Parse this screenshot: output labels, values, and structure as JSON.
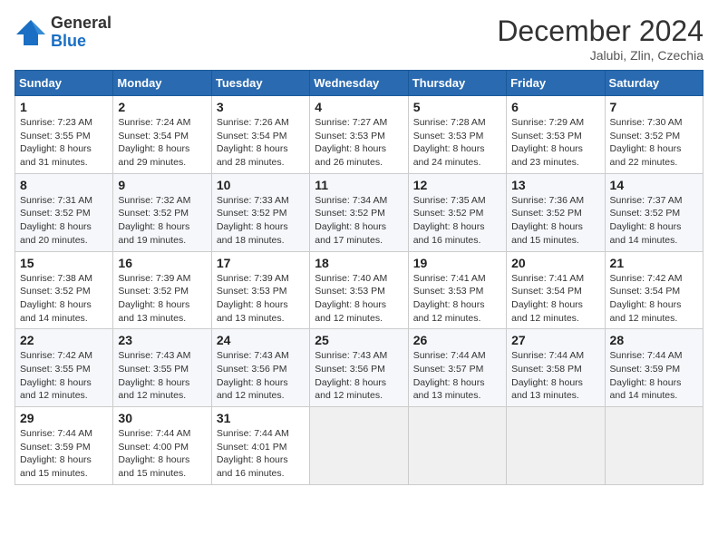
{
  "logo": {
    "general": "General",
    "blue": "Blue"
  },
  "header": {
    "title": "December 2024",
    "subtitle": "Jalubi, Zlin, Czechia"
  },
  "days_of_week": [
    "Sunday",
    "Monday",
    "Tuesday",
    "Wednesday",
    "Thursday",
    "Friday",
    "Saturday"
  ],
  "weeks": [
    [
      {
        "day": "1",
        "sunrise": "7:23 AM",
        "sunset": "3:55 PM",
        "daylight": "8 hours and 31 minutes."
      },
      {
        "day": "2",
        "sunrise": "7:24 AM",
        "sunset": "3:54 PM",
        "daylight": "8 hours and 29 minutes."
      },
      {
        "day": "3",
        "sunrise": "7:26 AM",
        "sunset": "3:54 PM",
        "daylight": "8 hours and 28 minutes."
      },
      {
        "day": "4",
        "sunrise": "7:27 AM",
        "sunset": "3:53 PM",
        "daylight": "8 hours and 26 minutes."
      },
      {
        "day": "5",
        "sunrise": "7:28 AM",
        "sunset": "3:53 PM",
        "daylight": "8 hours and 24 minutes."
      },
      {
        "day": "6",
        "sunrise": "7:29 AM",
        "sunset": "3:53 PM",
        "daylight": "8 hours and 23 minutes."
      },
      {
        "day": "7",
        "sunrise": "7:30 AM",
        "sunset": "3:52 PM",
        "daylight": "8 hours and 22 minutes."
      }
    ],
    [
      {
        "day": "8",
        "sunrise": "7:31 AM",
        "sunset": "3:52 PM",
        "daylight": "8 hours and 20 minutes."
      },
      {
        "day": "9",
        "sunrise": "7:32 AM",
        "sunset": "3:52 PM",
        "daylight": "8 hours and 19 minutes."
      },
      {
        "day": "10",
        "sunrise": "7:33 AM",
        "sunset": "3:52 PM",
        "daylight": "8 hours and 18 minutes."
      },
      {
        "day": "11",
        "sunrise": "7:34 AM",
        "sunset": "3:52 PM",
        "daylight": "8 hours and 17 minutes."
      },
      {
        "day": "12",
        "sunrise": "7:35 AM",
        "sunset": "3:52 PM",
        "daylight": "8 hours and 16 minutes."
      },
      {
        "day": "13",
        "sunrise": "7:36 AM",
        "sunset": "3:52 PM",
        "daylight": "8 hours and 15 minutes."
      },
      {
        "day": "14",
        "sunrise": "7:37 AM",
        "sunset": "3:52 PM",
        "daylight": "8 hours and 14 minutes."
      }
    ],
    [
      {
        "day": "15",
        "sunrise": "7:38 AM",
        "sunset": "3:52 PM",
        "daylight": "8 hours and 14 minutes."
      },
      {
        "day": "16",
        "sunrise": "7:39 AM",
        "sunset": "3:52 PM",
        "daylight": "8 hours and 13 minutes."
      },
      {
        "day": "17",
        "sunrise": "7:39 AM",
        "sunset": "3:53 PM",
        "daylight": "8 hours and 13 minutes."
      },
      {
        "day": "18",
        "sunrise": "7:40 AM",
        "sunset": "3:53 PM",
        "daylight": "8 hours and 12 minutes."
      },
      {
        "day": "19",
        "sunrise": "7:41 AM",
        "sunset": "3:53 PM",
        "daylight": "8 hours and 12 minutes."
      },
      {
        "day": "20",
        "sunrise": "7:41 AM",
        "sunset": "3:54 PM",
        "daylight": "8 hours and 12 minutes."
      },
      {
        "day": "21",
        "sunrise": "7:42 AM",
        "sunset": "3:54 PM",
        "daylight": "8 hours and 12 minutes."
      }
    ],
    [
      {
        "day": "22",
        "sunrise": "7:42 AM",
        "sunset": "3:55 PM",
        "daylight": "8 hours and 12 minutes."
      },
      {
        "day": "23",
        "sunrise": "7:43 AM",
        "sunset": "3:55 PM",
        "daylight": "8 hours and 12 minutes."
      },
      {
        "day": "24",
        "sunrise": "7:43 AM",
        "sunset": "3:56 PM",
        "daylight": "8 hours and 12 minutes."
      },
      {
        "day": "25",
        "sunrise": "7:43 AM",
        "sunset": "3:56 PM",
        "daylight": "8 hours and 12 minutes."
      },
      {
        "day": "26",
        "sunrise": "7:44 AM",
        "sunset": "3:57 PM",
        "daylight": "8 hours and 13 minutes."
      },
      {
        "day": "27",
        "sunrise": "7:44 AM",
        "sunset": "3:58 PM",
        "daylight": "8 hours and 13 minutes."
      },
      {
        "day": "28",
        "sunrise": "7:44 AM",
        "sunset": "3:59 PM",
        "daylight": "8 hours and 14 minutes."
      }
    ],
    [
      {
        "day": "29",
        "sunrise": "7:44 AM",
        "sunset": "3:59 PM",
        "daylight": "8 hours and 15 minutes."
      },
      {
        "day": "30",
        "sunrise": "7:44 AM",
        "sunset": "4:00 PM",
        "daylight": "8 hours and 15 minutes."
      },
      {
        "day": "31",
        "sunrise": "7:44 AM",
        "sunset": "4:01 PM",
        "daylight": "8 hours and 16 minutes."
      },
      null,
      null,
      null,
      null
    ]
  ],
  "labels": {
    "sunrise": "Sunrise:",
    "sunset": "Sunset:",
    "daylight": "Daylight:"
  }
}
